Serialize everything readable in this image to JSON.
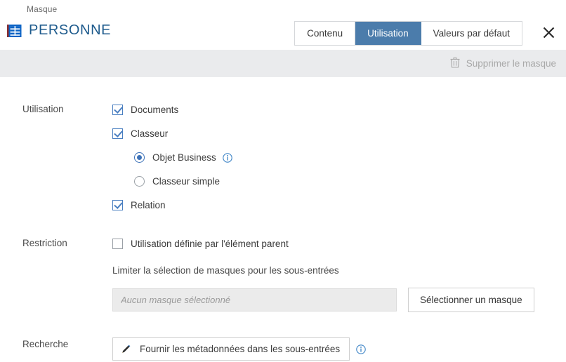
{
  "header": {
    "breadcrumb": "Masque",
    "title": "PERSONNE",
    "title_icon": "table-icon",
    "close_icon": "close-icon",
    "tabs": [
      {
        "label": "Contenu",
        "active": false
      },
      {
        "label": "Utilisation",
        "active": true
      },
      {
        "label": "Valeurs par défaut",
        "active": false
      }
    ]
  },
  "toolbar": {
    "delete_label": "Supprimer le masque",
    "delete_icon": "trash-icon"
  },
  "form": {
    "usage": {
      "label": "Utilisation",
      "options": [
        {
          "label": "Documents",
          "checked": true
        },
        {
          "label": "Classeur",
          "checked": true
        },
        {
          "label": "Relation",
          "checked": true
        }
      ],
      "radios": [
        {
          "label": "Objet Business",
          "selected": true,
          "info_icon": "info-icon"
        },
        {
          "label": "Classeur simple",
          "selected": false
        }
      ]
    },
    "restriction": {
      "label": "Restriction",
      "checkbox_label": "Utilisation définie par l'élément parent",
      "checkbox_checked": false,
      "hint": "Limiter la sélection de masques pour les sous-entrées",
      "input_placeholder": "Aucun masque sélectionné",
      "input_value": "",
      "select_button": "Sélectionner un masque"
    },
    "search": {
      "label": "Recherche",
      "button_label": "Fournir les métadonnées dans les sous-entrées",
      "button_icon": "pencil-icon",
      "info_icon": "info-icon"
    }
  },
  "colors": {
    "accent_blue": "#4b7cab",
    "title_blue": "#1d5a8c",
    "toolbar_grey": "#eaebed",
    "control_blue": "#4a7fc1"
  }
}
